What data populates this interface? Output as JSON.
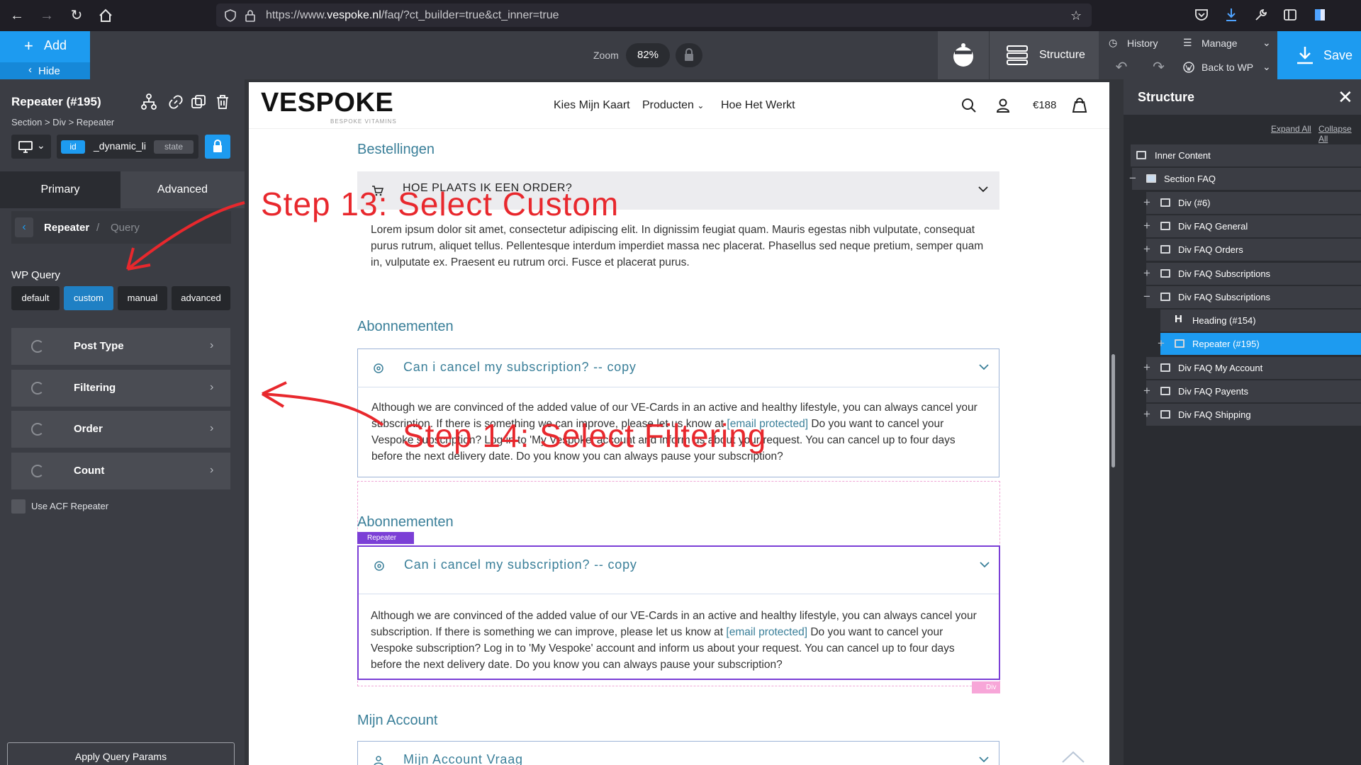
{
  "browser": {
    "url_prefix": "https://www.",
    "url_domain": "vespoke.nl",
    "url_path": "/faq/?ct_builder=true&ct_inner=true"
  },
  "topbar": {
    "add_label": "Add",
    "hide_label": "Hide",
    "zoom_label": "Zoom",
    "zoom_value": "82%",
    "structure_label": "Structure",
    "history_label": "History",
    "manage_label": "Manage",
    "back_to_wp_label": "Back to WP",
    "save_label": "Save"
  },
  "left_panel": {
    "element_title": "Repeater (#195)",
    "breadcrumb": "Section > Div > Repeater",
    "id_badge": "id",
    "id_value": "_dynamic_li",
    "state_badge": "state",
    "tabs": {
      "primary": "Primary",
      "advanced": "Advanced"
    },
    "sub_breadcrumb": {
      "current": "Repeater",
      "separator": "/",
      "child": "Query"
    },
    "wp_query_label": "WP Query",
    "wp_query_options": [
      "default",
      "custom",
      "manual",
      "advanced"
    ],
    "wp_query_selected": "custom",
    "accordion": [
      "Post Type",
      "Filtering",
      "Order",
      "Count"
    ],
    "acf_label": "Use ACF Repeater",
    "apply_label": "Apply Query Params"
  },
  "site": {
    "logo": "VESPOKE",
    "logo_sub": "BESPOKE VITAMINS",
    "menu": [
      "Kies Mijn Kaart",
      "Producten",
      "Hoe Het Werkt"
    ],
    "cart_amount": "€188"
  },
  "faq": {
    "section1_heading": "Bestellingen",
    "q1": "HOE PLAATS IK EEN ORDER?",
    "a1": "Lorem ipsum dolor sit amet, consectetur adipiscing elit. In dignissim feugiat quam. Mauris egestas nibh vulputate, consequat purus rutrum, aliquet tellus. Pellentesque interdum imperdiet massa nec placerat. Phasellus sed neque pretium, semper quam in, vulputate ex. Praesent eu rutrum orci. Fusce et placerat purus.",
    "section2_heading": "Abonnementen",
    "q2": "Can i cancel my subscription? -- copy",
    "a2_part1": "Although we are convinced of the added value of our VE-Cards in an active and healthy lifestyle, you can always cancel your subscription. If there is something we can improve, please let us know at",
    "a2_link": "[email protected]",
    "a2_part2": "Do you want to cancel your Vespoke subscription? Log in to 'My Vespoke' account and inform us about your request. You can cancel up to four days before the next delivery date. Do you know you can always pause your subscription?",
    "section3_heading": "Abonnementen",
    "q3": "Can i cancel my subscription? -- copy",
    "section4_heading": "Mijn Account",
    "q4": "Mijn Account Vraag",
    "repeater_tag": "Repeater",
    "div_tag": "Div"
  },
  "structure": {
    "title": "Structure",
    "expand_all": "Expand All",
    "collapse_all": "Collapse All",
    "items": [
      {
        "label": "Inner Content",
        "toggle": "",
        "icon": "inner-content-icon"
      },
      {
        "label": "Section FAQ",
        "toggle": "−",
        "icon": "section-icon"
      },
      {
        "label": "Div (#6)",
        "toggle": "+",
        "icon": "div-icon"
      },
      {
        "label": "Div FAQ General",
        "toggle": "+",
        "icon": "div-icon"
      },
      {
        "label": "Div FAQ Orders",
        "toggle": "+",
        "icon": "div-icon"
      },
      {
        "label": "Div FAQ Subscriptions",
        "toggle": "+",
        "icon": "div-icon"
      },
      {
        "label": "Div FAQ Subscriptions",
        "toggle": "−",
        "icon": "div-icon"
      },
      {
        "label": "Heading (#154)",
        "toggle": "",
        "icon": "heading-icon"
      },
      {
        "label": "Repeater (#195)",
        "toggle": "+",
        "icon": "repeater-icon"
      },
      {
        "label": "Div FAQ My Account",
        "toggle": "+",
        "icon": "div-icon"
      },
      {
        "label": "Div FAQ Payents",
        "toggle": "+",
        "icon": "div-icon"
      },
      {
        "label": "Div FAQ Shipping",
        "toggle": "+",
        "icon": "div-icon"
      }
    ],
    "active_index": 8
  },
  "annotations": {
    "step13": "Step 13: Select Custom",
    "step14": "Step 14: Select Filtering",
    "color": "#e8282d"
  }
}
